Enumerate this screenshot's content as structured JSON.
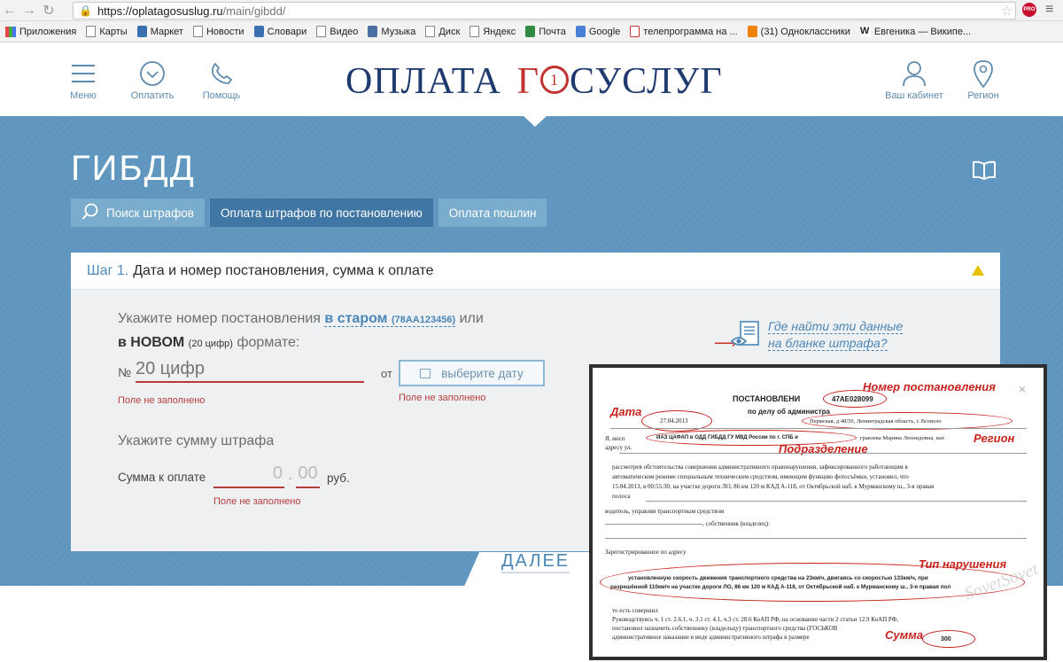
{
  "browser": {
    "url_host": "https://oplatagosuslug.ru",
    "url_path": "/main/gibdd/",
    "bookmarks": [
      "Приложения",
      "Карты",
      "Маркет",
      "Новости",
      "Словари",
      "Видео",
      "Музыка",
      "Диск",
      "Яндекс",
      "Почта",
      "Google",
      "телепрограмма на ...",
      "(31) Одноклассники",
      "Евгеника — Википе..."
    ],
    "ext_badge": "PRO"
  },
  "header": {
    "menu_label": "Меню",
    "pay_label": "Оплатить",
    "help_label": "Помощь",
    "logo_part1": "ОПЛАТА",
    "logo_part2": "Г",
    "logo_circle": "1",
    "logo_part3": "СУСЛУГ",
    "cabinet_label": "Ваш кабинет",
    "region_label": "Регион"
  },
  "page": {
    "title": "ГИБДД",
    "tabs": [
      "Поиск штрафов",
      "Оплата штрафов по постановлению",
      "Оплата пошлин"
    ]
  },
  "form": {
    "step_label": "Шаг 1.",
    "step_title": "Дата и номер постановления, сумма к оплате",
    "hint_pre": "Укажите номер постановления",
    "hint_old": "в старом",
    "hint_old_example": "(78АА123456)",
    "hint_or": "или",
    "hint_new": "в НОВОМ",
    "hint_new_count": "(20 цифр)",
    "hint_format": "формате:",
    "num_prefix": "№",
    "num_placeholder": "20 цифр",
    "num_error": "Поле не заполнено",
    "date_from": "от",
    "date_button": "выберите дату",
    "date_error": "Поле не заполнено",
    "where_line1": "Где найти эти данные",
    "where_line2": "на бланке штрафа?",
    "sum_hint": "Укажите сумму штрафа",
    "sum_label": "Сумма к оплате",
    "sum_int": "0",
    "sum_dot": ".",
    "sum_frac": "00",
    "sum_currency": "руб.",
    "sum_error": "Поле не заполнено",
    "next_button": "ДАЛЕЕ"
  },
  "sample_doc": {
    "heading": "ПОСТАНОВЛЕНИ",
    "number": "47АЕ028099",
    "subheading": "по делу об администра",
    "date": "27.04.2013",
    "address": "Пермская, д.48/50, Ленинградская область, г. Всеволо",
    "line_inspector": "Я, инсп",
    "line_unit": "ИАЗ ЦАФАП в ОДД ГИБДД ГУ МВД России по г. СПБ и",
    "line_name": "гравлева Марина Леонидовна, нах",
    "line_address": "адресу ул.",
    "body1": "рассмотрев обстоятельства совершения административного правонарушения, зафиксированного работающим в",
    "body2": "автоматическом режиме специальным техническим средством, имеющим функцию фотосъёмки, установил, что",
    "body3": "15.04.2013, в 00:55:30, на участке дороги ЛО, 86 км 120 м КАД А-118, от Октябрьской наб. к Мурманскому ш., 3-я правая",
    "body4": "полоса",
    "driver": "водитель, управляя транспортным средством",
    "owner": ", собственник (владелец):",
    "registered": "Зарегистрированное по адресу",
    "violation1": "установленную скорость движения транспортного средства на 23км/ч, двигаясь со скоростью 133км/ч, при",
    "violation2": "разрешённой 110км/ч на участке дороги ЛО, 86 км 120 м КАД А-118, от Октябрьской наб. к Мурманскому ш., 3-я правая пол",
    "committed": "то есть совершил",
    "rukov": "Руководствуясь ч. 1 ст. 2.6.1, ч. 3.1 ст. 4.1, ч.3 ст. 28.6 КоАП РФ, на основании части 2 статьи 12.9 КоАП РФ,",
    "postanovil": "постановил назначить собственнику (владельцу) транспортного средства (ГОСЬКОВ",
    "admin": "административное наказание в виде административного штрафа в размере",
    "amount": "300",
    "ann_number": "Номер постановления",
    "ann_date": "Дата",
    "ann_region": "Регион",
    "ann_unit": "Подразделение",
    "ann_violation": "Тип нарушения",
    "ann_sum": "Сумма",
    "watermark": "SovetSovet"
  }
}
